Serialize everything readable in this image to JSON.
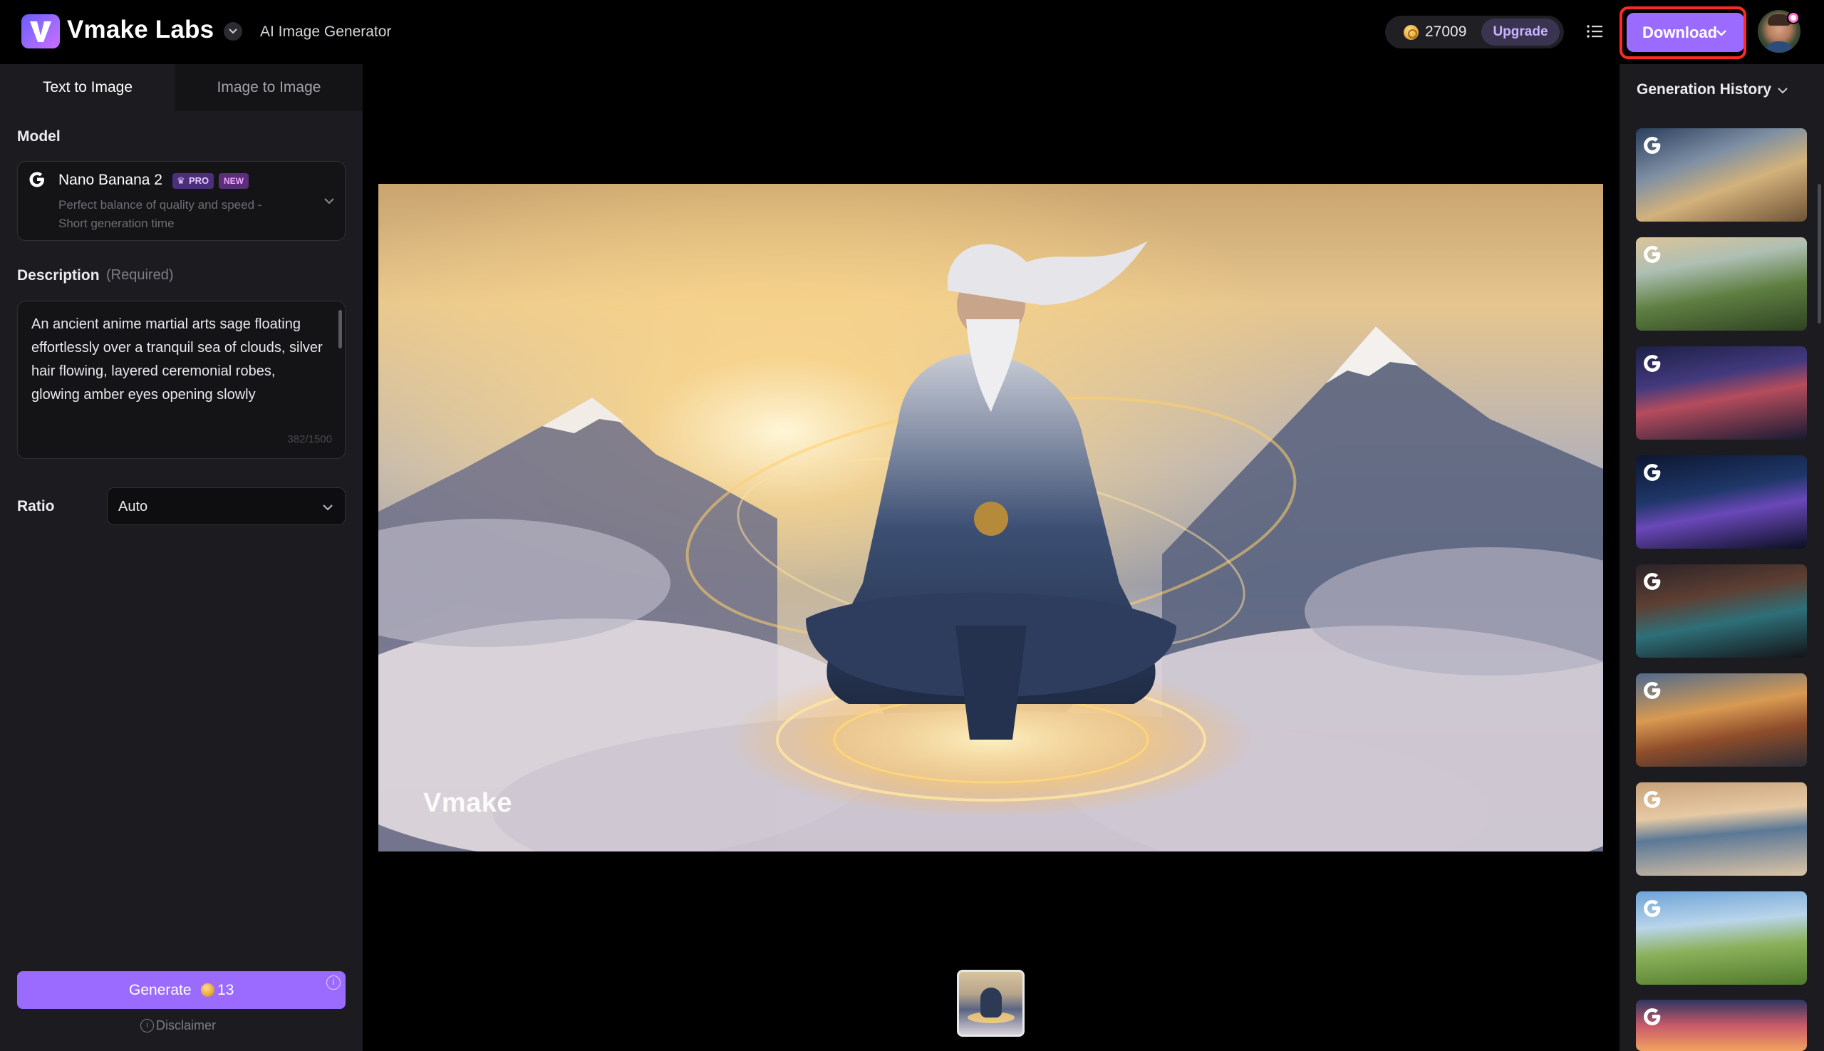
{
  "header": {
    "brand": "Vmake Labs",
    "app_subtitle": "AI Image Generator",
    "credits": "27009",
    "upgrade_label": "Upgrade",
    "download_label": "Download"
  },
  "tabs": [
    {
      "label": "Text to Image",
      "active": true
    },
    {
      "label": "Image to Image",
      "active": false
    }
  ],
  "model": {
    "section_label": "Model",
    "name": "Nano Banana 2",
    "badge_pro": "PRO",
    "badge_new": "NEW",
    "description": "Perfect balance of quality and speed - Short generation time"
  },
  "description": {
    "section_label": "Description",
    "required_label": "(Required)",
    "text": "An ancient anime martial arts sage floating effortlessly over a tranquil sea of clouds, silver hair flowing, layered ceremonial robes, glowing amber eyes opening slowly",
    "counter": "382/1500"
  },
  "ratio": {
    "label": "Ratio",
    "value": "Auto"
  },
  "generate": {
    "label": "Generate",
    "cost": "13",
    "disclaimer": "Disclaimer"
  },
  "main_image": {
    "watermark": "Vmake"
  },
  "history": {
    "title": "Generation History",
    "items": 9
  },
  "colors": {
    "accent": "#9b6bff",
    "panel": "#1c1c20",
    "highlight_outline": "#ff2a20"
  }
}
